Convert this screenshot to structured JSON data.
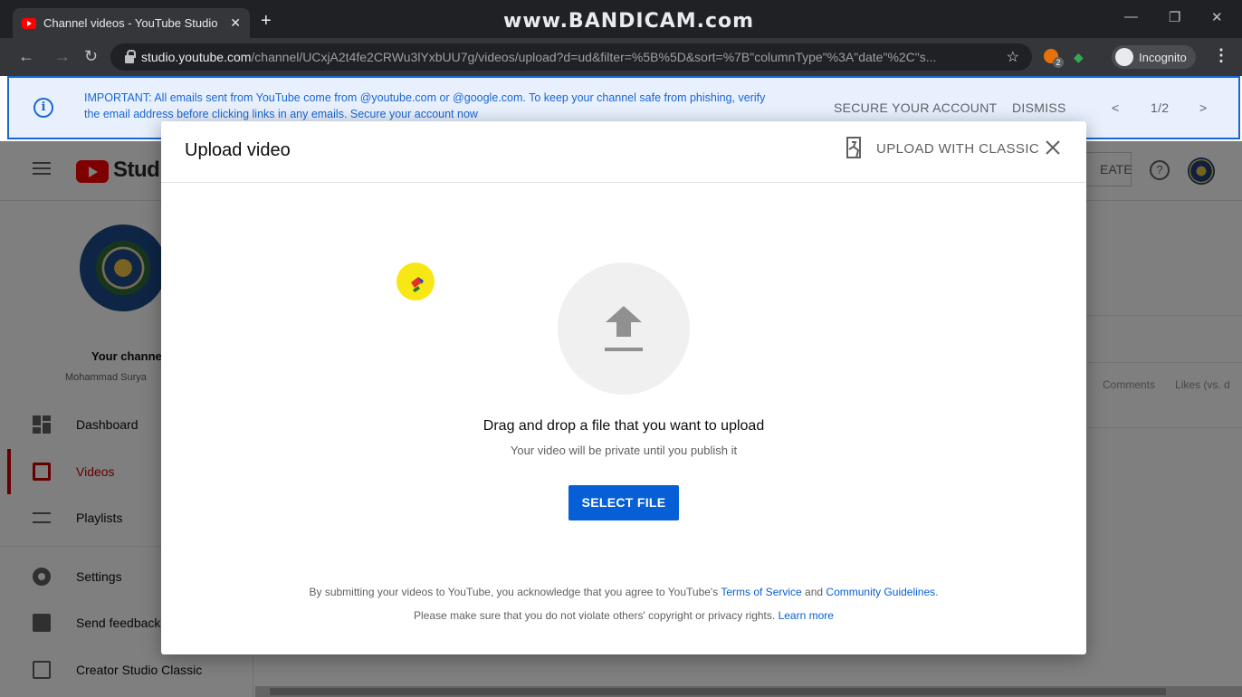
{
  "browser": {
    "tab_title": "Channel videos - YouTube Studio",
    "tab_close": "✕",
    "new_tab": "+",
    "watermark": "www.BANDICAM.com",
    "url_host": "studio.youtube.com",
    "url_path": "/channel/UCxjA2t4fe2CRWu3lYxbUU7g/videos/upload?d=ud&filter=%5B%5D&sort=%7B\"columnType\"%3A\"date\"%2C\"s...",
    "extension_badge": "2",
    "incognito_label": "Incognito"
  },
  "banner": {
    "message": "IMPORTANT: All emails sent from YouTube come from @youtube.com or @google.com. To keep your channel safe from phishing, verify the email address before clicking links in any emails. Secure your account now",
    "secure_label": "SECURE YOUR ACCOUNT",
    "dismiss_label": "DISMISS",
    "pager": "1/2"
  },
  "header": {
    "studio_label": "Studio",
    "create_label": "EATE",
    "help_glyph": "?"
  },
  "sidebar": {
    "channel_title": "Your channe",
    "channel_owner": "Mohammad Surya",
    "items": [
      {
        "label": "Dashboard",
        "icon": "dashboard-icon"
      },
      {
        "label": "Videos",
        "icon": "videos-icon"
      },
      {
        "label": "Playlists",
        "icon": "playlists-icon"
      },
      {
        "label": "Settings",
        "icon": "settings-icon"
      },
      {
        "label": "Send feedback",
        "icon": "feedback-icon"
      },
      {
        "label": "Creator Studio Classic",
        "icon": "classic-icon"
      }
    ]
  },
  "table": {
    "col_comments": "Comments",
    "col_likes": "Likes (vs. d"
  },
  "modal": {
    "title": "Upload video",
    "classic_label": "UPLOAD WITH CLASSIC",
    "drag_text": "Drag and drop a file that you want to upload",
    "private_text": "Your video will be private until you publish it",
    "select_label": "SELECT FILE",
    "legal_prefix": "By submitting your videos to YouTube, you acknowledge that you agree to YouTube's",
    "terms_label": "Terms of Service",
    "legal_and": "and",
    "guidelines_label": "Community Guidelines",
    "legal_period": ".",
    "copyright_text": "Please make sure that you do not violate others' copyright or privacy rights.",
    "learn_more": "Learn more"
  },
  "colors": {
    "accent": "#065fd4",
    "brand_red": "#ff0000",
    "banner_blue": "#1967d2"
  }
}
